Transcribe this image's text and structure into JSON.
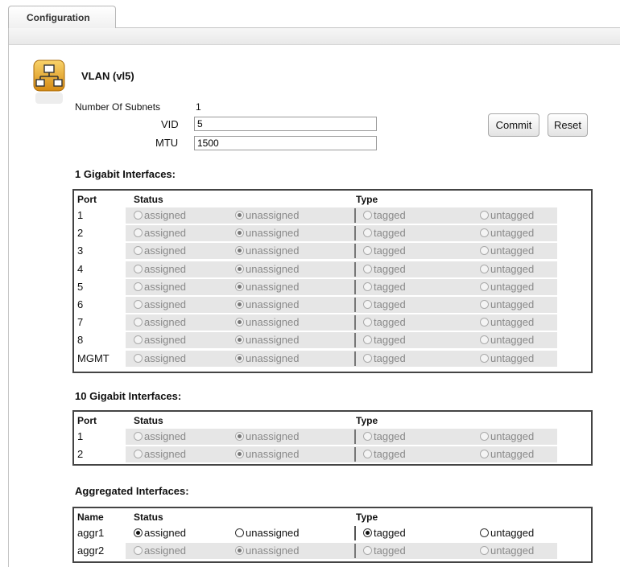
{
  "tab": {
    "label": "Configuration"
  },
  "vlan": {
    "title": "VLAN (vl5)",
    "subnets_label": "Number Of Subnets",
    "subnets_value": "1",
    "vid_label": "VID",
    "vid_value": "5",
    "mtu_label": "MTU",
    "mtu_value": "1500"
  },
  "buttons": {
    "commit": "Commit",
    "reset": "Reset"
  },
  "options": {
    "assigned": "assigned",
    "unassigned": "unassigned",
    "tagged": "tagged",
    "untagged": "untagged"
  },
  "gig": {
    "title": "1 Gigabit Interfaces:",
    "headers": {
      "port": "Port",
      "status": "Status",
      "type": "Type"
    },
    "rows": [
      {
        "port": "1",
        "status": "unassigned",
        "type": ""
      },
      {
        "port": "2",
        "status": "unassigned",
        "type": ""
      },
      {
        "port": "3",
        "status": "unassigned",
        "type": ""
      },
      {
        "port": "4",
        "status": "unassigned",
        "type": ""
      },
      {
        "port": "5",
        "status": "unassigned",
        "type": ""
      },
      {
        "port": "6",
        "status": "unassigned",
        "type": ""
      },
      {
        "port": "7",
        "status": "unassigned",
        "type": ""
      },
      {
        "port": "8",
        "status": "unassigned",
        "type": ""
      },
      {
        "port": "MGMT",
        "status": "unassigned",
        "type": ""
      }
    ]
  },
  "tengig": {
    "title": "10 Gigabit Interfaces:",
    "headers": {
      "port": "Port",
      "status": "Status",
      "type": "Type"
    },
    "rows": [
      {
        "port": "1",
        "status": "unassigned",
        "type": ""
      },
      {
        "port": "2",
        "status": "unassigned",
        "type": ""
      }
    ]
  },
  "aggr": {
    "title": "Aggregated Interfaces:",
    "headers": {
      "port": "Name",
      "status": "Status",
      "type": "Type"
    },
    "rows": [
      {
        "port": "aggr1",
        "status": "assigned",
        "type": "tagged",
        "enabled": true
      },
      {
        "port": "aggr2",
        "status": "unassigned",
        "type": "",
        "enabled": false
      }
    ]
  }
}
